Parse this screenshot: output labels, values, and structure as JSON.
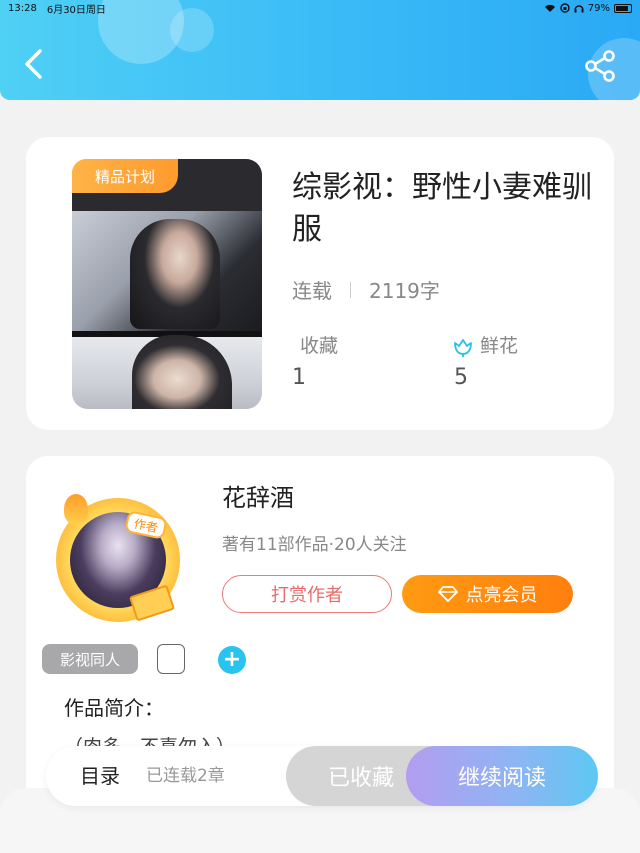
{
  "status_bar": {
    "time": "13:28",
    "date": "6月30日周日",
    "battery": "79%"
  },
  "header": {
    "back_icon": "chevron-left-icon",
    "share_icon": "share-icon"
  },
  "book": {
    "badge": "精品计划",
    "title": "综影视：野性小妻难驯服",
    "status": "连载",
    "word_count": "2119字",
    "favorites_label": "收藏",
    "favorites_value": "1",
    "flowers_label": "鲜花",
    "flowers_value": "5"
  },
  "author": {
    "avatar_badge": "作者",
    "name": "花辞酒",
    "info": "著有11部作品·20人关注",
    "tip_button": "打赏作者",
    "vip_button": "点亮会员"
  },
  "tags": {
    "items": [
      "影视同人"
    ],
    "add_icon": "plus-icon"
  },
  "intro": {
    "label": "作品简介：",
    "text": "（肉多，不喜勿入）"
  },
  "bottom_bar": {
    "toc_label": "目录",
    "chapters": "已连载2章",
    "collected_label": "已收藏",
    "read_label": "继续阅读"
  },
  "colors": {
    "header_accent": "#38b8f6",
    "vip_orange": "#ff8a12",
    "tip_red": "#e86b6b",
    "tag_blue": "#29c3ef"
  }
}
